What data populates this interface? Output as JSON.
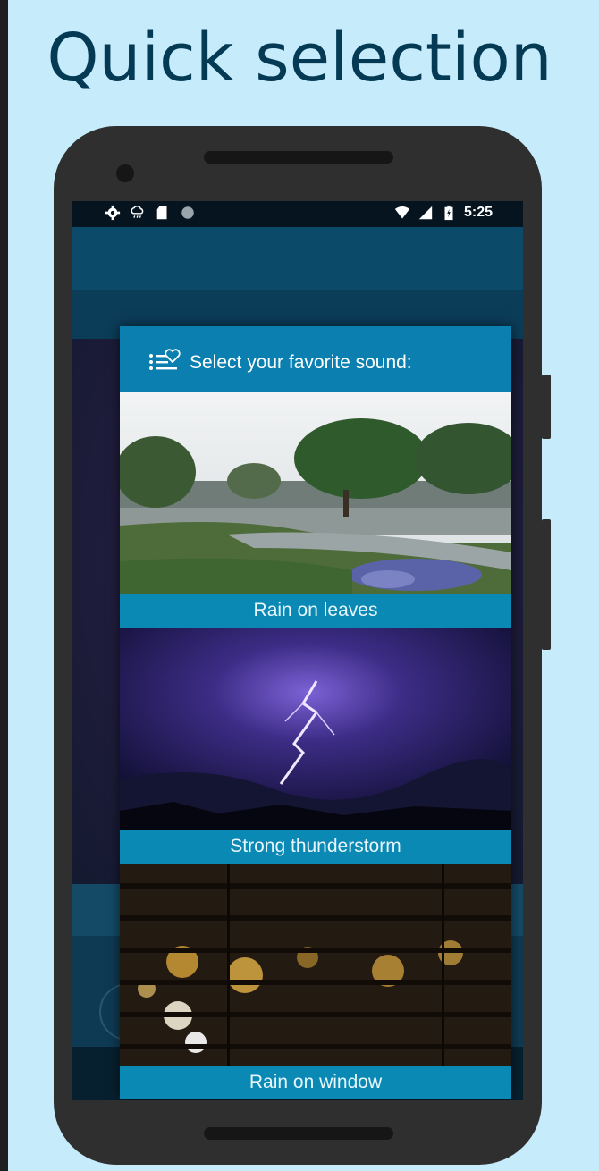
{
  "headline": "Quick selection",
  "status_bar": {
    "time": "5:25",
    "icons_left": [
      "settings-icon",
      "weather-icon",
      "sd-card-icon",
      "circle-icon"
    ],
    "icons_right": [
      "wifi-icon",
      "signal-icon",
      "battery-icon"
    ]
  },
  "dialog": {
    "title": "Select your favorite sound:",
    "icon": "favorite-list-icon",
    "sounds": [
      {
        "label": "Rain on leaves"
      },
      {
        "label": "Strong thunderstorm"
      },
      {
        "label": "Rain on window"
      }
    ]
  },
  "nav_bar": {
    "icons": [
      "back-icon",
      "home-icon",
      "recents-icon"
    ]
  },
  "colors": {
    "background": "#c6ecfb",
    "headline": "#053a55",
    "dialog_header": "#0b80b0",
    "label_bar": "#0b89b5"
  }
}
